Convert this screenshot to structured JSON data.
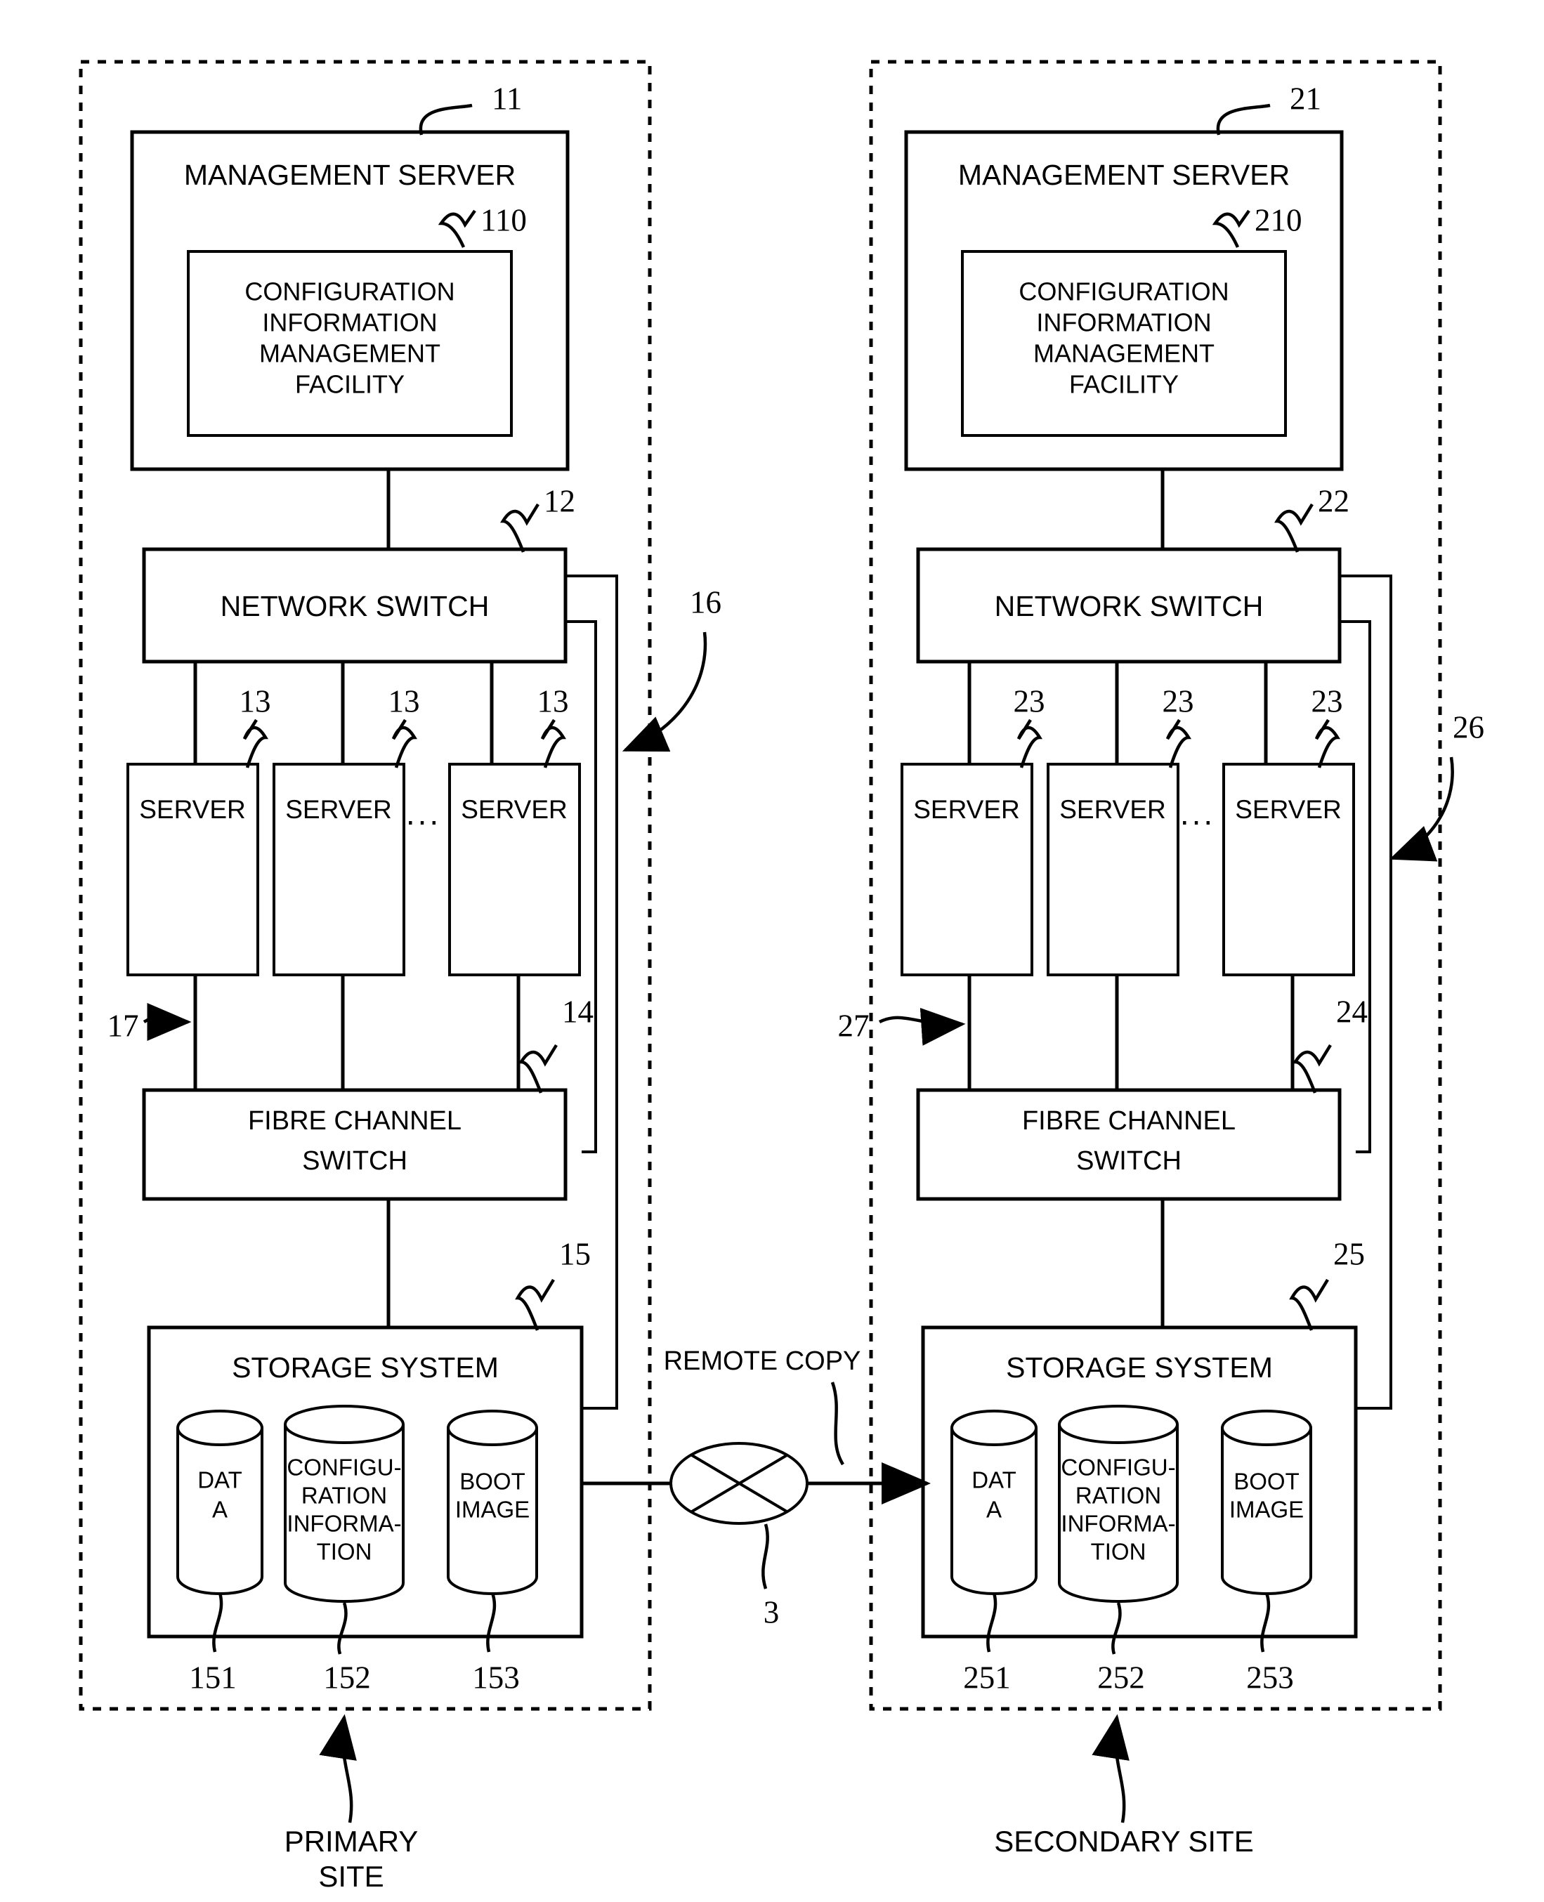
{
  "figure": {
    "type": "patent-block-diagram",
    "title": "Primary and secondary site storage system configuration"
  },
  "sites": [
    {
      "id": "primary",
      "caption_line1": "PRIMARY",
      "caption_line2": "SITE",
      "management_server": {
        "label": "MANAGEMENT SERVER",
        "ref": "11",
        "inner": {
          "lines": [
            "CONFIGURATION",
            "INFORMATION",
            "MANAGEMENT",
            "FACILITY"
          ],
          "ref": "110"
        }
      },
      "network_switch": {
        "label": "NETWORK SWITCH",
        "ref": "12"
      },
      "servers": [
        {
          "label": "SERVER",
          "ref": "13"
        },
        {
          "label": "SERVER",
          "ref": "13"
        },
        {
          "label": "SERVER",
          "ref": "13"
        }
      ],
      "server_ellipsis": "...",
      "fibre_channel_switch": {
        "line1": "FIBRE CHANNEL",
        "line2": "SWITCH",
        "ref": "14"
      },
      "storage_system": {
        "label": "STORAGE SYSTEM",
        "ref": "15",
        "volumes": [
          {
            "lines": [
              "DAT",
              "A"
            ],
            "ref": "151"
          },
          {
            "lines": [
              "CONFIGU-",
              "RATION",
              "INFORMA-",
              "TION"
            ],
            "ref": "152"
          },
          {
            "lines": [
              "BOOT",
              "IMAGE"
            ],
            "ref": "153"
          }
        ]
      },
      "network_arrow_ref": "16",
      "fc_arrow_ref": "17"
    },
    {
      "id": "secondary",
      "caption_line1": "SECONDARY SITE",
      "caption_line2": "",
      "management_server": {
        "label": "MANAGEMENT SERVER",
        "ref": "21",
        "inner": {
          "lines": [
            "CONFIGURATION",
            "INFORMATION",
            "MANAGEMENT",
            "FACILITY"
          ],
          "ref": "210"
        }
      },
      "network_switch": {
        "label": "NETWORK SWITCH",
        "ref": "22"
      },
      "servers": [
        {
          "label": "SERVER",
          "ref": "23"
        },
        {
          "label": "SERVER",
          "ref": "23"
        },
        {
          "label": "SERVER",
          "ref": "23"
        }
      ],
      "server_ellipsis": "...",
      "fibre_channel_switch": {
        "line1": "FIBRE CHANNEL",
        "line2": "SWITCH",
        "ref": "24"
      },
      "storage_system": {
        "label": "STORAGE SYSTEM",
        "ref": "25",
        "volumes": [
          {
            "lines": [
              "DAT",
              "A"
            ],
            "ref": "251"
          },
          {
            "lines": [
              "CONFIGU-",
              "RATION",
              "INFORMA-",
              "TION"
            ],
            "ref": "252"
          },
          {
            "lines": [
              "BOOT",
              "IMAGE"
            ],
            "ref": "253"
          }
        ]
      },
      "network_arrow_ref": "26",
      "fc_arrow_ref": "27"
    }
  ],
  "link": {
    "label": "REMOTE COPY",
    "ref": "3"
  },
  "colors": {
    "ink": "#000000",
    "paper": "#ffffff"
  }
}
